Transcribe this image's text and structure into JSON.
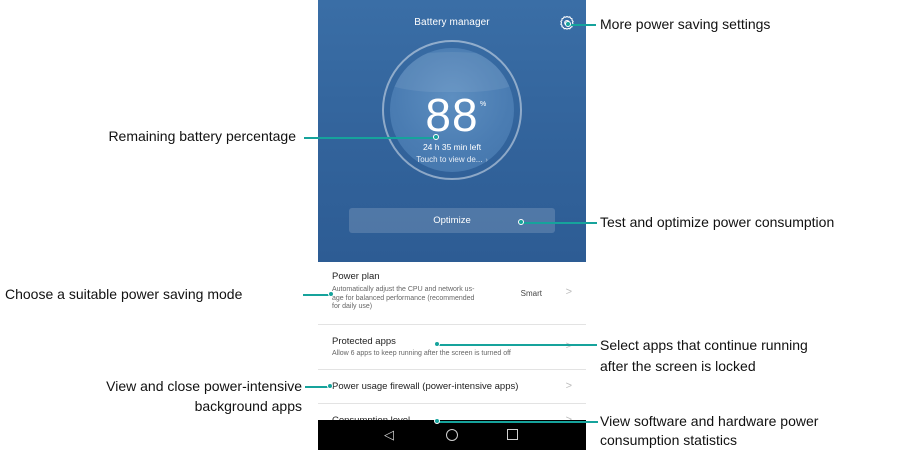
{
  "app": {
    "title": "Battery manager",
    "settings_icon": "gear-icon"
  },
  "battery": {
    "percent": "88",
    "percent_sign": "%",
    "time_left": "24 h 35 min left",
    "detail_link": "Touch to view de...",
    "detail_chevron": "›"
  },
  "optimize": {
    "label": "Optimize"
  },
  "list": {
    "power_plan": {
      "title": "Power plan",
      "desc_lines": [
        "Automatically adjust the CPU and network us-",
        "age for balanced performance (recommended",
        "for daily use)"
      ],
      "value": "Smart",
      "chevron": ">"
    },
    "protected_apps": {
      "title": "Protected apps",
      "desc": "Allow 6 apps to keep running after the screen is turned off",
      "chevron": ">"
    },
    "firewall": {
      "title": "Power usage firewall (power-intensive apps)",
      "chevron": ">"
    },
    "consumption": {
      "title": "Consumption level",
      "chevron": ">"
    }
  },
  "navbar": {
    "back": "◁",
    "home": "home-icon",
    "recent": "recent-apps-icon"
  },
  "callouts": {
    "settings": "More power saving settings",
    "battery": "Remaining battery percentage",
    "optimize": "Test and optimize power consumption",
    "mode": "Choose a suitable power saving mode",
    "protected": [
      "Select apps that continue running",
      "after the screen is locked"
    ],
    "firewall": [
      "View and close power-intensive",
      "background apps"
    ],
    "consumption": [
      "View software and hardware power",
      "consumption statistics"
    ]
  },
  "colors": {
    "hero": "#32639b",
    "callout_line": "#16a39c",
    "navbar": "#000000"
  }
}
